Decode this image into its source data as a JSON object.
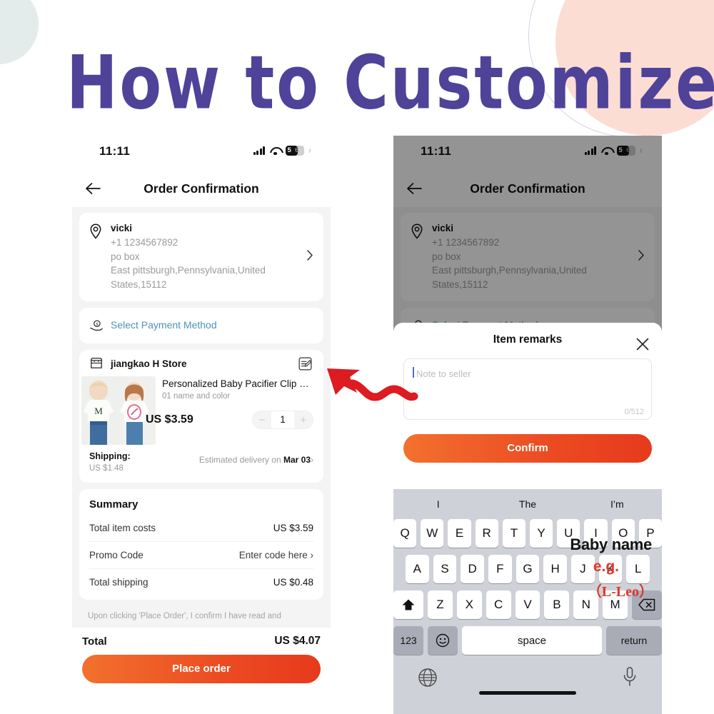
{
  "headline": "How to Customize",
  "colors": {
    "headline_purple": "#4e4299",
    "cta_orange_start": "#f2712e",
    "cta_orange_end": "#e63a1c",
    "annotation_red": "#e0392b",
    "link_blue": "#4b93b5",
    "page_bg": "#f4f4f4",
    "circle_pink": "#fbddd4",
    "circle_mint": "#e3ecea"
  },
  "status_bar": {
    "time": "11:11",
    "battery_level": "5",
    "battery_level_dim": "6",
    "icons": [
      "signal-icon",
      "wifi-icon",
      "battery-icon"
    ]
  },
  "nav": {
    "back_icon": "arrow-left-icon",
    "title": "Order Confirmation"
  },
  "address": {
    "icon": "location-pin-icon",
    "name": "vicki",
    "phone": "+1 1234567892",
    "line1": "po box",
    "line2": "East pittsburgh,Pennsylvania,United",
    "line3": "States,15112",
    "chevron": "chevron-right-icon"
  },
  "payment": {
    "icon": "payment-hand-coin-icon",
    "label": "Select Payment Method"
  },
  "store": {
    "icon": "store-icon",
    "name": "jiangkao H Store",
    "edit_icon": "edit-note-icon"
  },
  "item": {
    "title": "Personalized Baby Pacifier Clip Custo···",
    "variant": "01 name and color",
    "price": "US $3.59",
    "qty": "1",
    "minus": "−",
    "plus": "+"
  },
  "shipping": {
    "label": "Shipping:",
    "cost": "US $1.48",
    "estimate_prefix": "Estimated delivery on ",
    "estimate_date": "Mar 03",
    "chevron": "›"
  },
  "summary": {
    "heading": "Summary",
    "rows": [
      {
        "label": "Total item costs",
        "value": "US $3.59"
      },
      {
        "label": "Promo Code",
        "value": "Enter code here ›"
      },
      {
        "label": "Total shipping",
        "value": "US $0.48"
      }
    ]
  },
  "disclaimer": "Upon clicking 'Place Order', I confirm I have read and",
  "footer": {
    "total_label": "Total",
    "total_value": "US $4.07",
    "cta_label": "Place order"
  },
  "dialog": {
    "title": "Item remarks",
    "close_icon": "close-icon",
    "note_placeholder": "Note to seller",
    "note_value": "",
    "char_counter": "0/512",
    "confirm_label": "Confirm"
  },
  "annotations": {
    "baby_name": "Baby name",
    "eg": "e.g.",
    "example": "（L-Leo）",
    "arrow": "red-wavy-arrow-icon"
  },
  "keyboard": {
    "suggestions": [
      "I",
      "The",
      "I’m"
    ],
    "row1": [
      "Q",
      "W",
      "E",
      "R",
      "T",
      "Y",
      "U",
      "I",
      "O",
      "P"
    ],
    "row2": [
      "A",
      "S",
      "D",
      "F",
      "G",
      "H",
      "J",
      "K",
      "L"
    ],
    "row3": [
      "Z",
      "X",
      "C",
      "V",
      "B",
      "N",
      "M"
    ],
    "shift_icon": "shift-up-icon",
    "backspace_icon": "backspace-icon",
    "numbers_key": "123",
    "emoji_icon": "emoji-smiley-icon",
    "space_key": "space",
    "return_key": "return",
    "globe_icon": "globe-icon",
    "mic_icon": "microphone-icon"
  }
}
